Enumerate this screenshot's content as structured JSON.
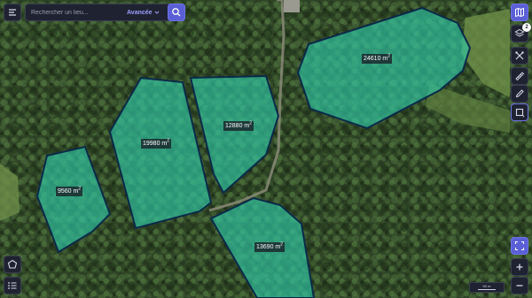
{
  "search": {
    "placeholder": "Rechercher un lieu...",
    "advanced_label": "Avancée"
  },
  "map": {
    "parcels": [
      {
        "area_value": "24610",
        "area_unit": "m",
        "unit_power": "2"
      },
      {
        "area_value": "19980",
        "area_unit": "m",
        "unit_power": "2"
      },
      {
        "area_value": "12880",
        "area_unit": "m",
        "unit_power": "2"
      },
      {
        "area_value": "9560",
        "area_unit": "m",
        "unit_power": "2"
      },
      {
        "area_value": "13690",
        "area_unit": "m",
        "unit_power": "2"
      }
    ]
  },
  "toolbar": {
    "layers_badge": "2"
  },
  "scale": {
    "label": "50 m"
  },
  "colors": {
    "accent": "#5a5fd6",
    "parcel_fill": "#2fc7a6",
    "parcel_outline": "#0b2a4a",
    "panel": "#1f2230"
  },
  "icons": {
    "menu": "filter-menu-icon",
    "search": "search-icon",
    "map": "map-icon",
    "layers": "layers-icon",
    "tools": "tools-icon",
    "ruler": "ruler-icon",
    "draw": "pencil-icon",
    "select": "select-square-icon",
    "polygon": "polygon-icon",
    "list": "list-icon",
    "fit": "fit-extent-icon",
    "zoom_in": "zoom-in-icon",
    "zoom_out": "zoom-out-icon"
  }
}
